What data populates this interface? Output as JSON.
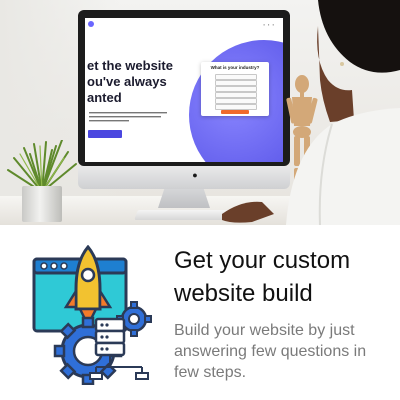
{
  "photo": {
    "screen": {
      "headline": "et the website\nou've always\nanted",
      "popup_title": "What is your industry?"
    }
  },
  "feature_card": {
    "title": "Get your custom website build",
    "description": "Build your website by just answering few questions in few steps."
  },
  "illustration": {
    "icon": "website-rocket-server-gears-icon",
    "colors": {
      "browser": "#2fc9d6",
      "outline": "#2b3a57",
      "rocket": "#f2c230",
      "gear": "#2f6fd8",
      "window_chrome": "#1e7fd1"
    }
  }
}
